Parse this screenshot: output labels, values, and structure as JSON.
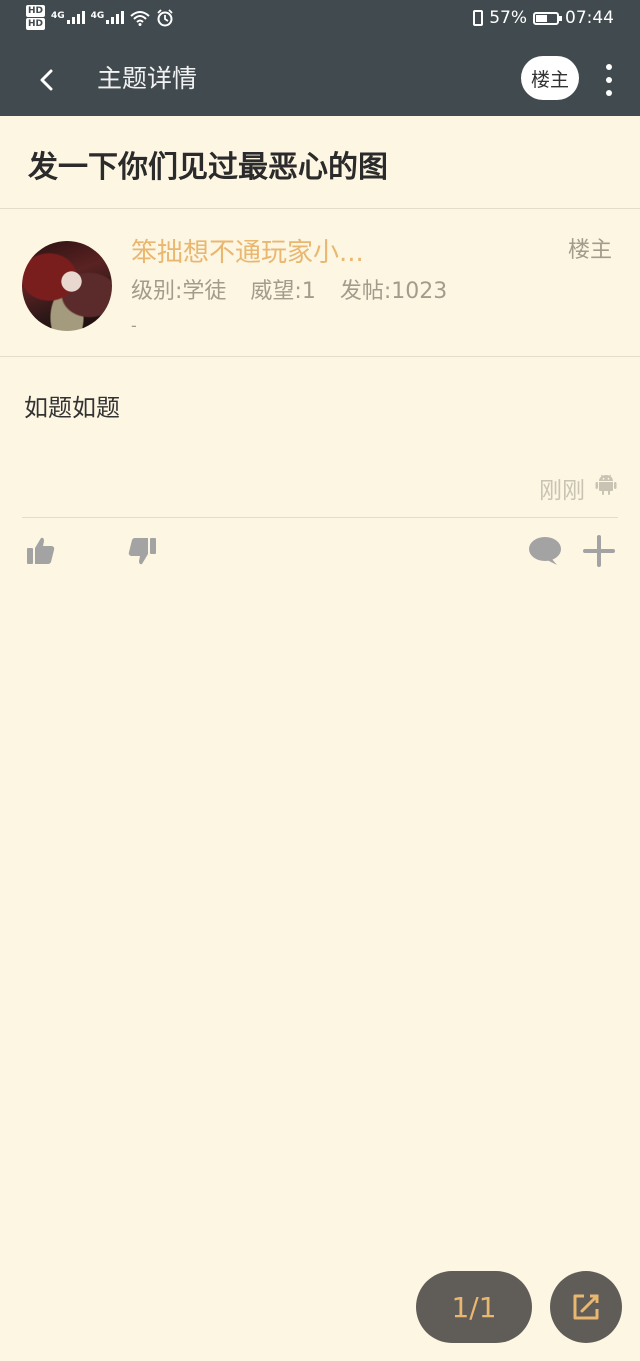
{
  "status_bar": {
    "battery_percent": "57%",
    "battery_level": 0.57,
    "time": "07:44",
    "network_tag_1": "4G",
    "network_tag_2": "4G",
    "hd_label": "HD"
  },
  "header": {
    "title": "主题详情",
    "owner_button": "楼主",
    "background": "#414a4f"
  },
  "topic": {
    "title": "发一下你们见过最恶心的图"
  },
  "post": {
    "username": "笨拙想不通玩家小...",
    "floor_tag": "楼主",
    "level": "级别:学徒",
    "prestige": "威望:1",
    "post_count": "发帖:1023",
    "signature": "-",
    "content": "如题如题",
    "time": "刚刚",
    "username_color": "#e9b76f"
  },
  "pager": {
    "label": "1/1"
  }
}
